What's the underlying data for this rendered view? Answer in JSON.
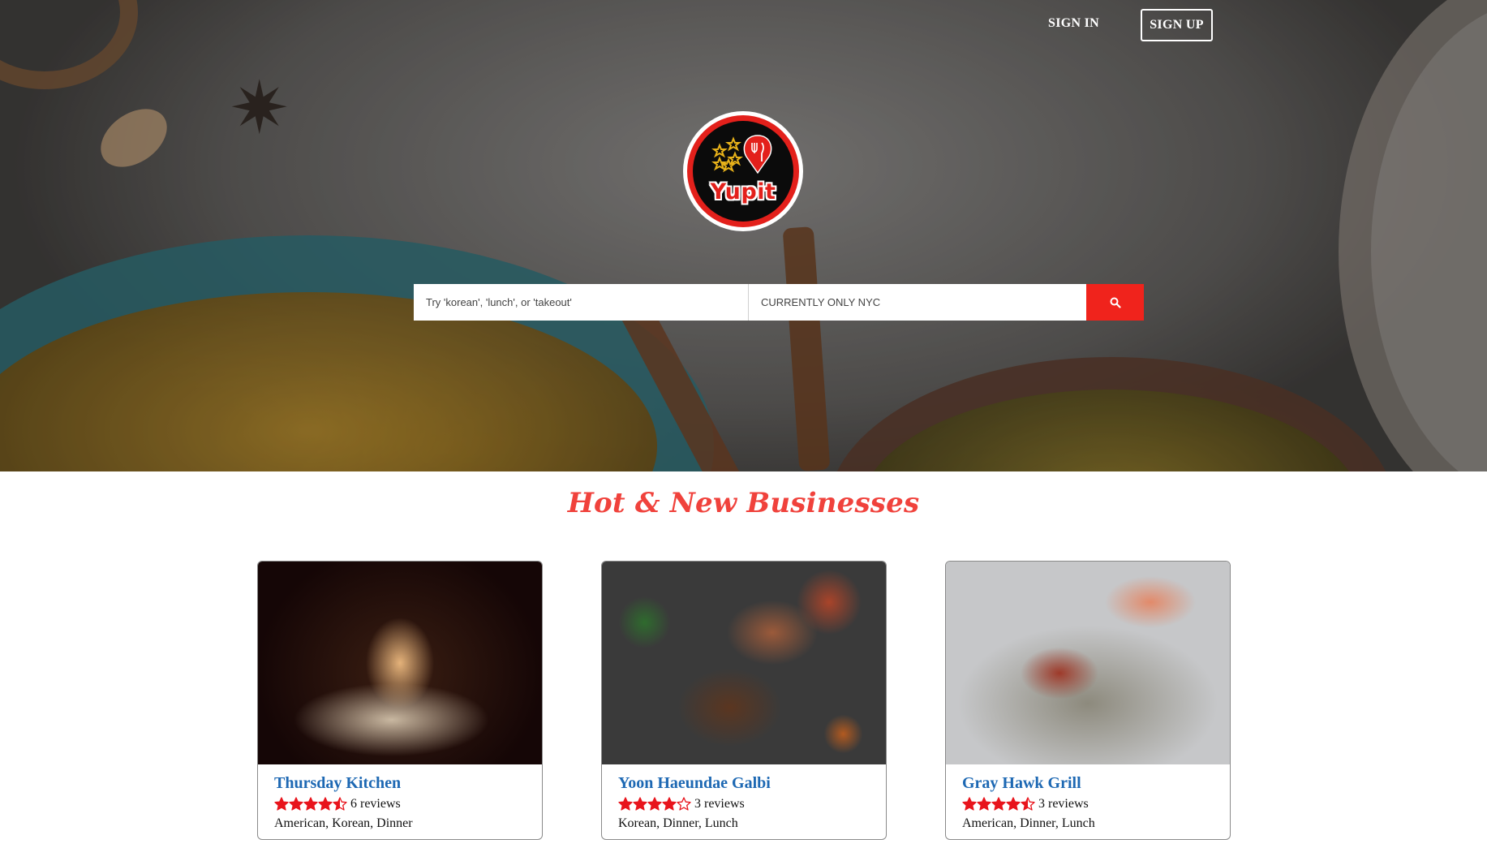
{
  "nav": {
    "sign_in": "SIGN IN",
    "sign_up": "SIGN UP"
  },
  "logo": {
    "text": "Yupit",
    "icon": "yupit-logo-icon"
  },
  "search": {
    "query_placeholder": "Try 'korean', 'lunch', or 'takeout'",
    "location_placeholder": "CURRENTLY ONLY NYC",
    "button_icon": "search-icon"
  },
  "section": {
    "title": "Hot & New Businesses"
  },
  "businesses": [
    {
      "name": "Thursday Kitchen",
      "rating": 4.5,
      "reviews": "6 reviews",
      "categories": "American,  Korean,  Dinner"
    },
    {
      "name": "Yoon Haeundae Galbi",
      "rating": 4,
      "reviews": "3 reviews",
      "categories": "Korean,  Dinner,  Lunch"
    },
    {
      "name": "Gray Hawk Grill",
      "rating": 4.5,
      "reviews": "3 reviews",
      "categories": "American,  Dinner,  Lunch"
    }
  ],
  "colors": {
    "accent_red": "#f0231c",
    "title_red": "#f0423c",
    "link_blue": "#1d68b3",
    "star_red": "#e8141c"
  }
}
